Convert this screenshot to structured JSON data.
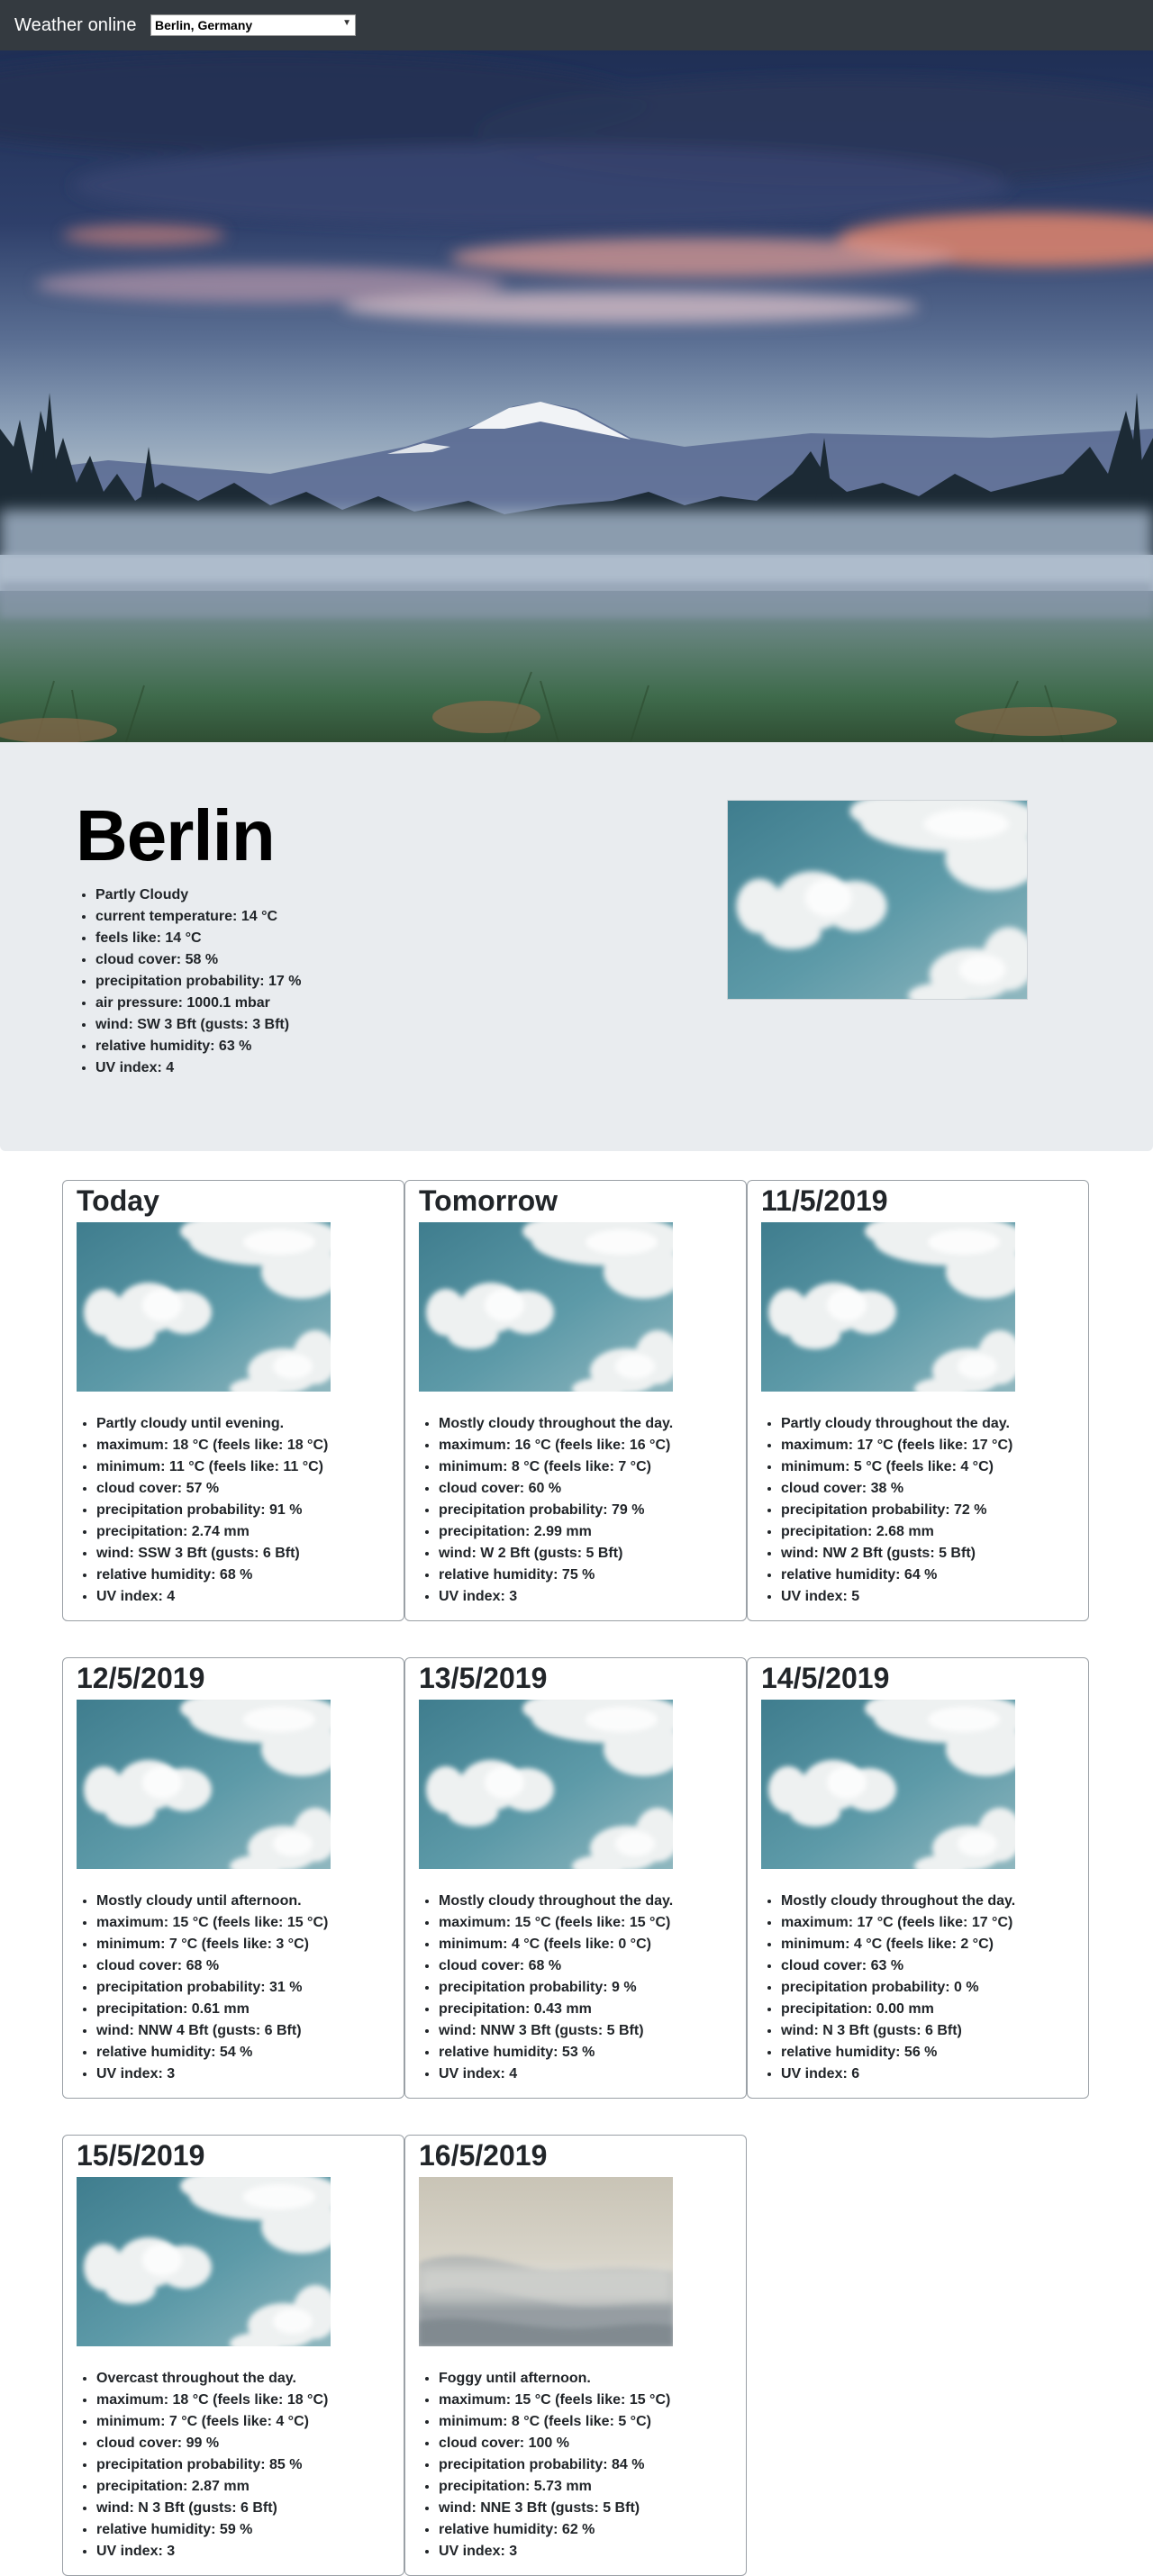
{
  "navbar": {
    "brand": "Weather online",
    "location_select": {
      "selected": "Berlin, Germany"
    }
  },
  "current": {
    "city": "Berlin",
    "details": [
      "Partly Cloudy",
      "current temperature: 14 °C",
      "feels like: 14 °C",
      "cloud cover: 58 %",
      "precipitation probability: 17 %",
      "air pressure: 1000.1 mbar",
      "wind: SW 3 Bft (gusts: 3 Bft)",
      "relative humidity: 63 %",
      "UV index: 4"
    ]
  },
  "forecast": [
    {
      "day": "Today",
      "photo": "clouds-photo",
      "details": [
        "Partly cloudy until evening.",
        "maximum: 18 °C (feels like: 18 °C)",
        "minimum: 11 °C (feels like: 11 °C)",
        "cloud cover: 57 %",
        "precipitation probability: 91 %",
        "precipitation: 2.74 mm",
        "wind: SSW 3 Bft (gusts: 6 Bft)",
        "relative humidity: 68 %",
        "UV index: 4"
      ]
    },
    {
      "day": "Tomorrow",
      "photo": "clouds-photo",
      "details": [
        "Mostly cloudy throughout the day.",
        "maximum: 16 °C (feels like: 16 °C)",
        "minimum: 8 °C (feels like: 7 °C)",
        "cloud cover: 60 %",
        "precipitation probability: 79 %",
        "precipitation: 2.99 mm",
        "wind: W 2 Bft (gusts: 5 Bft)",
        "relative humidity: 75 %",
        "UV index: 3"
      ]
    },
    {
      "day": "11/5/2019",
      "photo": "clouds-photo",
      "details": [
        "Partly cloudy throughout the day.",
        "maximum: 17 °C (feels like: 17 °C)",
        "minimum: 5 °C (feels like: 4 °C)",
        "cloud cover: 38 %",
        "precipitation probability: 72 %",
        "precipitation: 2.68 mm",
        "wind: NW 2 Bft (gusts: 5 Bft)",
        "relative humidity: 64 %",
        "UV index: 5"
      ]
    },
    {
      "day": "12/5/2019",
      "photo": "clouds-photo",
      "details": [
        "Mostly cloudy until afternoon.",
        "maximum: 15 °C (feels like: 15 °C)",
        "minimum: 7 °C (feels like: 3 °C)",
        "cloud cover: 68 %",
        "precipitation probability: 31 %",
        "precipitation: 0.61 mm",
        "wind: NNW 4 Bft (gusts: 6 Bft)",
        "relative humidity: 54 %",
        "UV index: 3"
      ]
    },
    {
      "day": "13/5/2019",
      "photo": "clouds-photo",
      "details": [
        "Mostly cloudy throughout the day.",
        "maximum: 15 °C (feels like: 15 °C)",
        "minimum: 4 °C (feels like: 0 °C)",
        "cloud cover: 68 %",
        "precipitation probability: 9 %",
        "precipitation: 0.43 mm",
        "wind: NNW 3 Bft (gusts: 5 Bft)",
        "relative humidity: 53 %",
        "UV index: 4"
      ]
    },
    {
      "day": "14/5/2019",
      "photo": "clouds-photo",
      "details": [
        "Mostly cloudy throughout the day.",
        "maximum: 17 °C (feels like: 17 °C)",
        "minimum: 4 °C (feels like: 2 °C)",
        "cloud cover: 63 %",
        "precipitation probability: 0 %",
        "precipitation: 0.00 mm",
        "wind: N 3 Bft (gusts: 6 Bft)",
        "relative humidity: 56 %",
        "UV index: 6"
      ]
    },
    {
      "day": "15/5/2019",
      "photo": "clouds-photo",
      "details": [
        "Overcast throughout the day.",
        "maximum: 18 °C (feels like: 18 °C)",
        "minimum: 7 °C (feels like: 4 °C)",
        "cloud cover: 99 %",
        "precipitation probability: 85 %",
        "precipitation: 2.87 mm",
        "wind: N 3 Bft (gusts: 6 Bft)",
        "relative humidity: 59 %",
        "UV index: 3"
      ]
    },
    {
      "day": "16/5/2019",
      "photo": "fog-photo",
      "details": [
        "Foggy until afternoon.",
        "maximum: 15 °C (feels like: 15 °C)",
        "minimum: 8 °C (feels like: 5 °C)",
        "cloud cover: 100 %",
        "precipitation probability: 84 %",
        "precipitation: 5.73 mm",
        "wind: NNE 3 Bft (gusts: 5 Bft)",
        "relative humidity: 62 %",
        "UV index: 3"
      ]
    }
  ]
}
